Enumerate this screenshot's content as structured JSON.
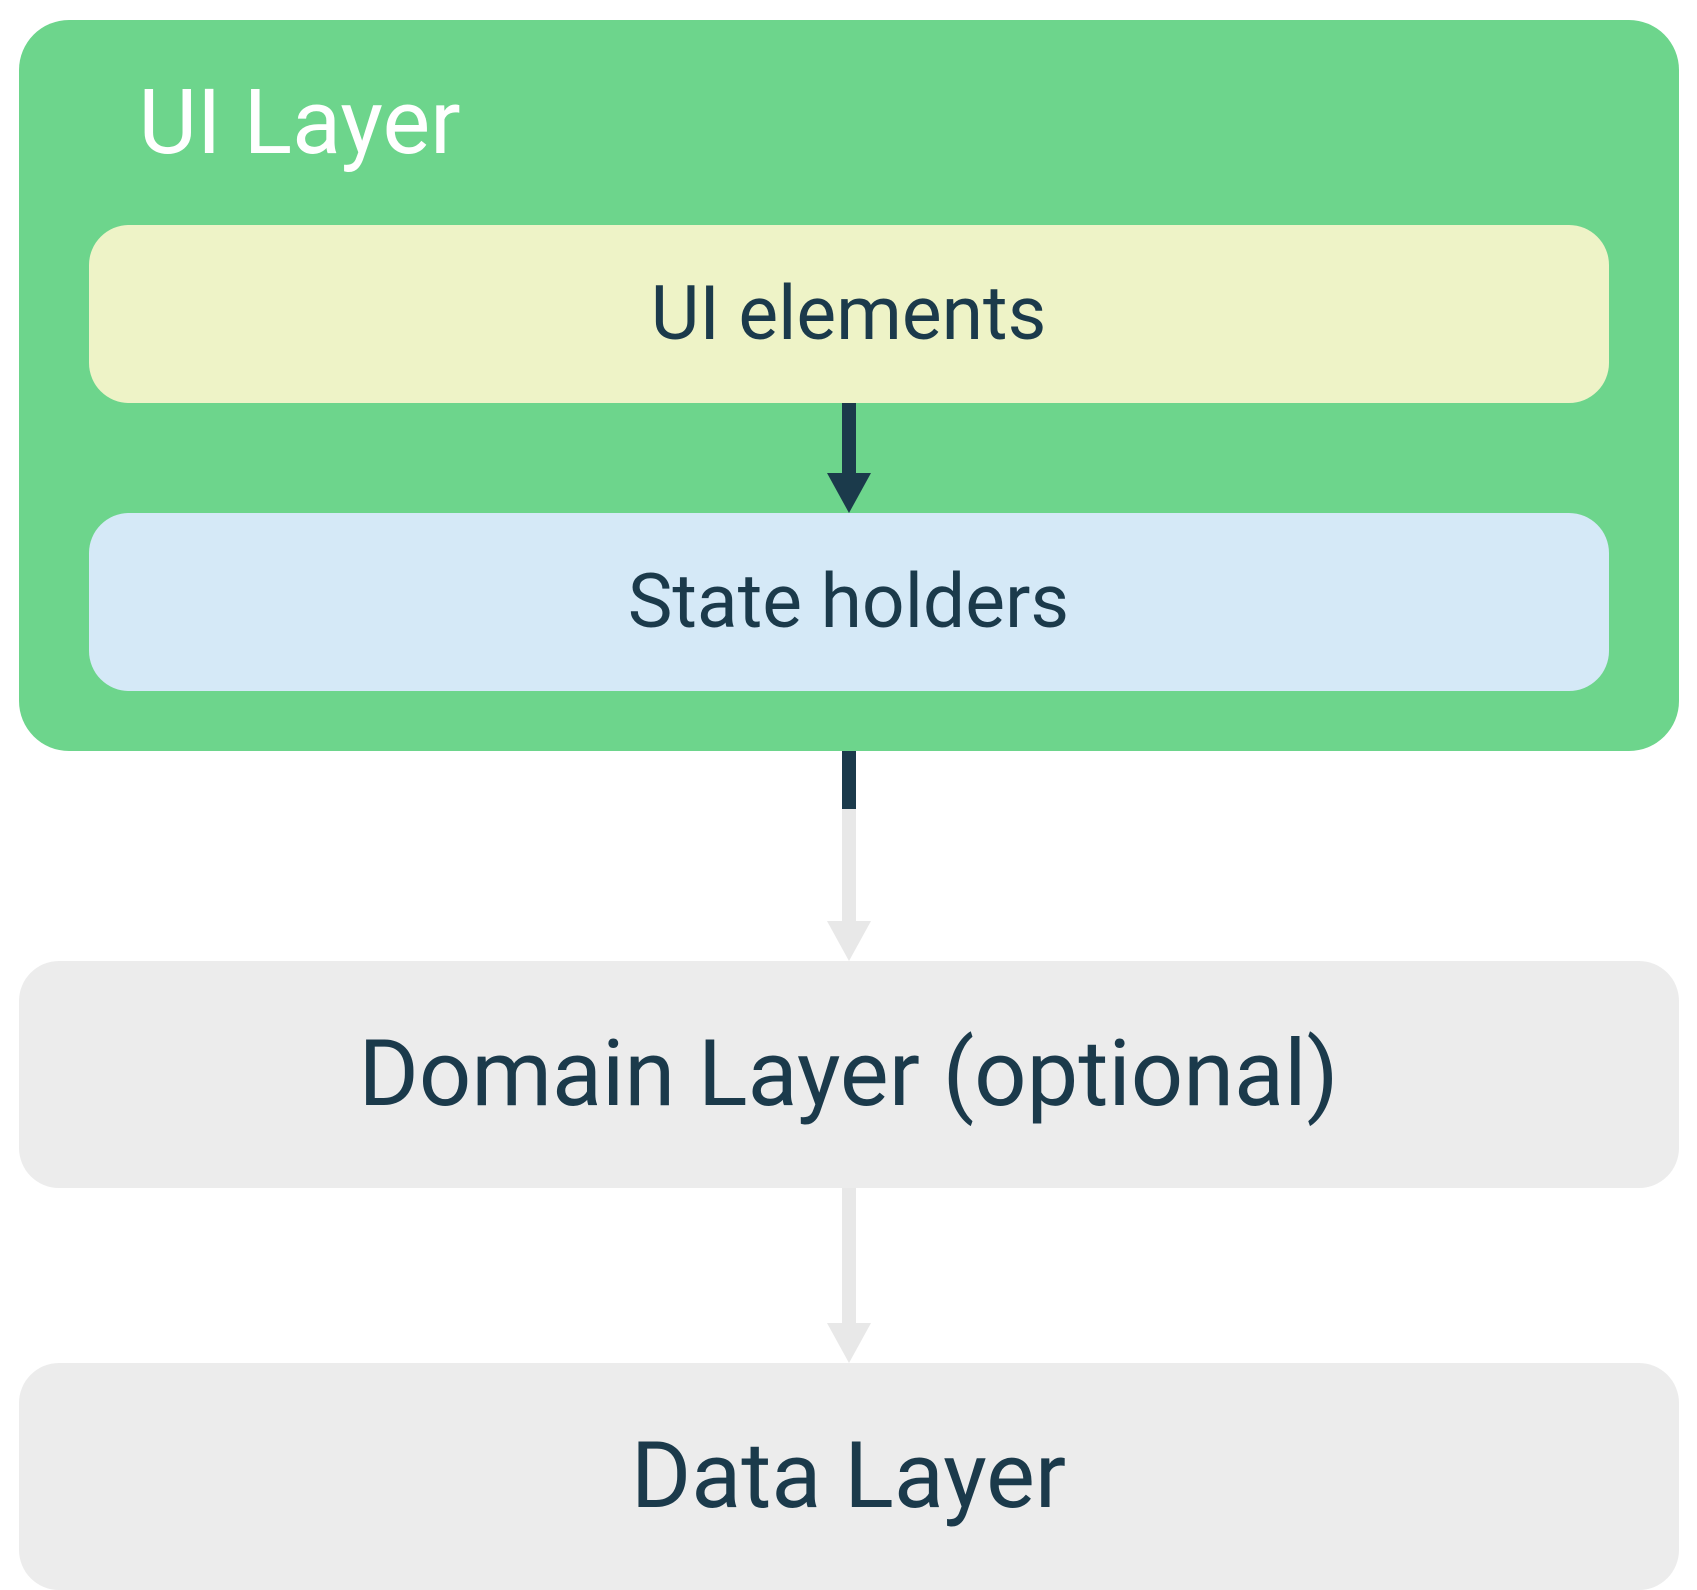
{
  "layers": {
    "ui_layer": {
      "title": "UI Layer",
      "ui_elements": "UI elements",
      "state_holders": "State holders"
    },
    "domain_layer": "Domain Layer (optional)",
    "data_layer": "Data Layer"
  },
  "colors": {
    "ui_layer_bg": "#6dd58c",
    "ui_elements_bg": "#eef3c7",
    "state_holders_bg": "#d5e9f7",
    "outer_box_bg": "#ececec",
    "text_dark": "#1b3a4b",
    "text_light": "#ffffff",
    "arrow_dark": "#1b3a4b",
    "arrow_light": "#e8e8e8"
  }
}
